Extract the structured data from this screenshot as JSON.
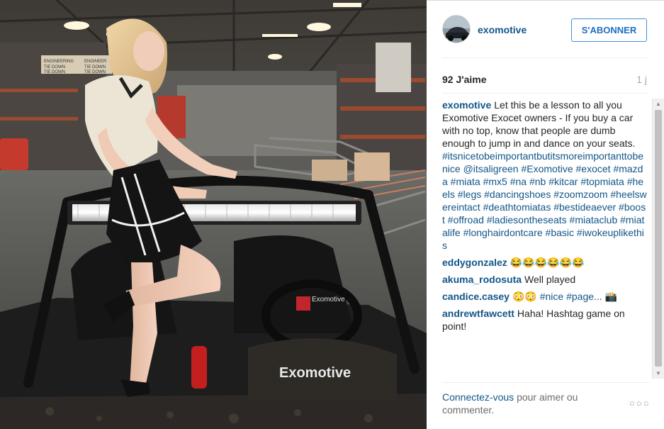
{
  "post": {
    "username": "exomotive",
    "follow_label": "S'ABONNER",
    "likes": "92 J'aime",
    "time_ago": "1 j",
    "caption": {
      "user": "exomotive",
      "text": "Let this be a lesson to all you Exomotive Exocet owners - If you buy a car with no top, know that people are dumb enough to jump in and dance on your seats.",
      "tags": "#itsnicetobeimportantbutitsmoreimportanttobenice @itsaligreen #Exomotive #exocet #mazda #miata #mx5 #na #nb #kitcar #topmiata #heels #legs #dancingshoes #zoomzoom #heelswereintact #deathtomiatas #bestideaever #boost #offroad #ladiesontheseats #miataclub #miatalife #longhairdontcare #basic #iwokeuplikethis"
    },
    "comments": [
      {
        "user": "eddygonzalez",
        "text": "😂😂😂😂😂😂"
      },
      {
        "user": "akuma_rodosuta",
        "text": "Well played"
      },
      {
        "user": "candice.casey",
        "text": "😳😳 #nice #page... 📸"
      },
      {
        "user": "andrewtfawcett",
        "text": "Haha! Hashtag game on point!"
      }
    ],
    "footer": {
      "login_link": "Connectez-vous",
      "login_rest": "pour aimer ou commenter."
    },
    "more_icon": "ellipsis-icon"
  },
  "photo": {
    "brand_text_car": "Exomotive",
    "steering_brand": "Exomotive",
    "sign_left_1": "ENGINEERING",
    "sign_left_2": "TIE DOWN",
    "sign_left_3": "TIE DOWN",
    "sign_right_1": "ENGINEER",
    "sign_right_2": "TIE DOWN",
    "sign_right_3": "TIE DOWN"
  },
  "colors": {
    "link": "#125688",
    "follow_border": "#4090db"
  }
}
